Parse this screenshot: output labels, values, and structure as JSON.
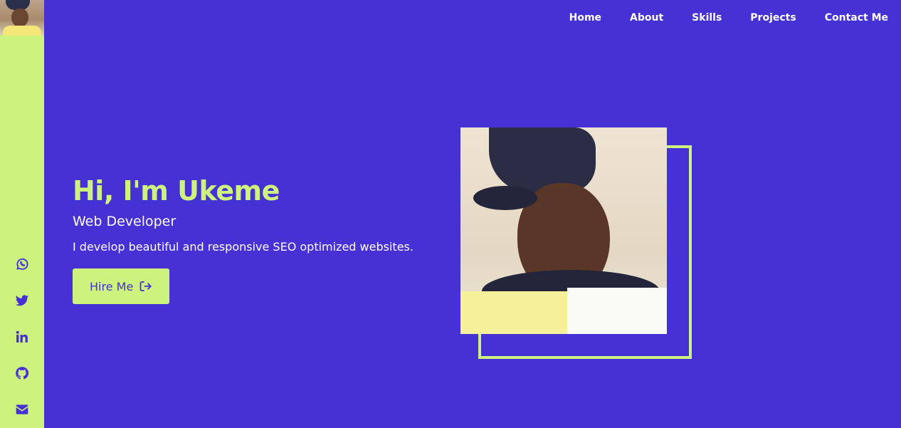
{
  "nav": {
    "items": [
      {
        "label": "Home"
      },
      {
        "label": "About"
      },
      {
        "label": "Skills"
      },
      {
        "label": "Projects"
      },
      {
        "label": "Contact Me"
      }
    ]
  },
  "hero": {
    "title": "Hi, I'm Ukeme",
    "role": "Web Developer",
    "description": "I develop beautiful and responsive SEO optimized websites.",
    "button_label": "Hire Me",
    "button_icon": "sign-out-icon"
  },
  "social": {
    "icons": [
      "whatsapp-icon",
      "twitter-icon",
      "linkedin-icon",
      "github-icon",
      "envelope-icon"
    ]
  },
  "colors": {
    "background": "#4631d4",
    "accent": "#cdf27e",
    "text": "#ffffff"
  }
}
